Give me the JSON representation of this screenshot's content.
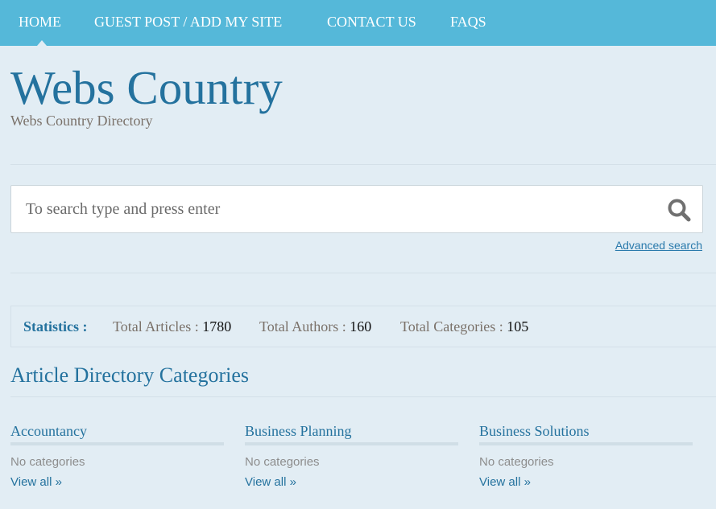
{
  "nav": {
    "items": [
      {
        "label": "HOME",
        "active": true
      },
      {
        "label": "GUEST POST / ADD MY SITE"
      },
      {
        "label": "CONTACT US"
      },
      {
        "label": "FAQS"
      }
    ]
  },
  "header": {
    "title": "Webs Country",
    "tagline": "Webs Country Directory"
  },
  "search": {
    "placeholder": "To search type and press enter",
    "value": "",
    "icon": "search-icon",
    "advanced_label": "Advanced search"
  },
  "statistics": {
    "label": "Statistics :",
    "items": [
      {
        "label": "Total Articles :",
        "value": "1780"
      },
      {
        "label": "Total Authors :",
        "value": "160"
      },
      {
        "label": "Total Categories :",
        "value": "105"
      }
    ]
  },
  "categories_section": {
    "title": "Article Directory Categories",
    "categories": [
      {
        "name": "Accountancy",
        "subtext": "No categories",
        "link": "View all »"
      },
      {
        "name": "Business Planning",
        "subtext": "No categories",
        "link": "View all »"
      },
      {
        "name": "Business Solutions",
        "subtext": "No categories",
        "link": "View all »"
      }
    ]
  },
  "colors": {
    "nav_bg": "#55b8d9",
    "page_bg": "#e2edf4",
    "accent": "#24729e"
  }
}
